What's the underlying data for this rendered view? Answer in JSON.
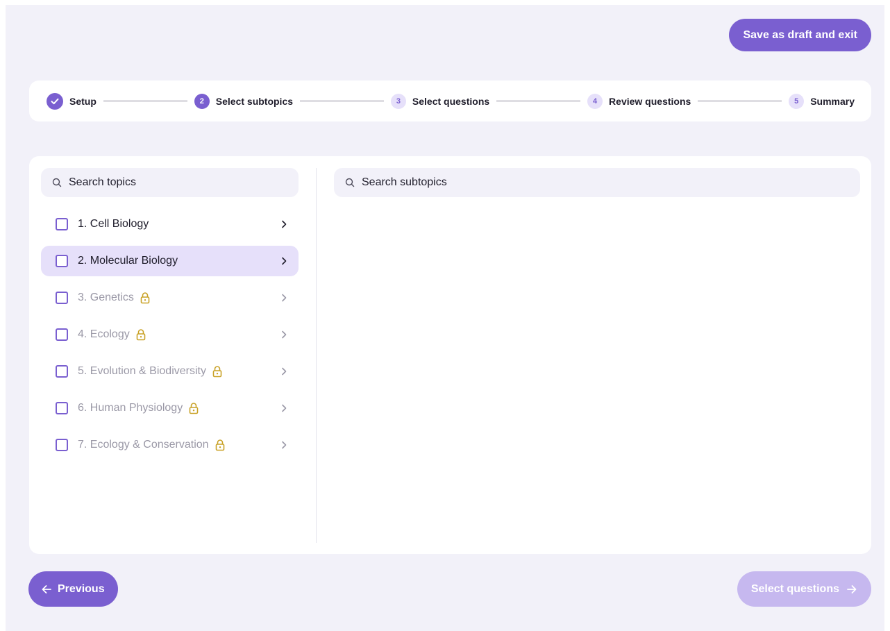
{
  "header": {
    "save_label": "Save as draft and exit"
  },
  "stepper": {
    "steps": [
      {
        "number": "",
        "label": "Setup",
        "state": "done"
      },
      {
        "number": "2",
        "label": "Select subtopics",
        "state": "active"
      },
      {
        "number": "3",
        "label": "Select questions",
        "state": "pending"
      },
      {
        "number": "4",
        "label": "Review questions",
        "state": "pending"
      },
      {
        "number": "5",
        "label": "Summary",
        "state": "pending"
      }
    ]
  },
  "topics_panel": {
    "search_placeholder": "Search topics",
    "items": [
      {
        "label": "1. Cell Biology",
        "locked": false,
        "selected": false,
        "checked": false
      },
      {
        "label": "2. Molecular Biology",
        "locked": false,
        "selected": true,
        "checked": false
      },
      {
        "label": "3. Genetics",
        "locked": true,
        "selected": false,
        "checked": false
      },
      {
        "label": "4. Ecology",
        "locked": true,
        "selected": false,
        "checked": false
      },
      {
        "label": "5. Evolution & Biodiversity",
        "locked": true,
        "selected": false,
        "checked": false
      },
      {
        "label": "6. Human Physiology",
        "locked": true,
        "selected": false,
        "checked": false
      },
      {
        "label": "7. Ecology & Conservation",
        "locked": true,
        "selected": false,
        "checked": false
      }
    ]
  },
  "subtopics_panel": {
    "search_placeholder": "Search subtopics"
  },
  "footer": {
    "previous_label": "Previous",
    "next_label": "Select questions"
  },
  "colors": {
    "accent": "#7a5fd0",
    "accent_light": "#e6e0fa",
    "accent_disabled": "#c6b8ef",
    "lock": "#c9a227",
    "background": "#f2f1f9"
  },
  "icons": {
    "search": "search-icon",
    "check": "check-icon",
    "chevron": "chevron-right-icon",
    "lock": "lock-icon",
    "arrow_left": "arrow-left-icon",
    "arrow_right": "arrow-right-icon"
  }
}
